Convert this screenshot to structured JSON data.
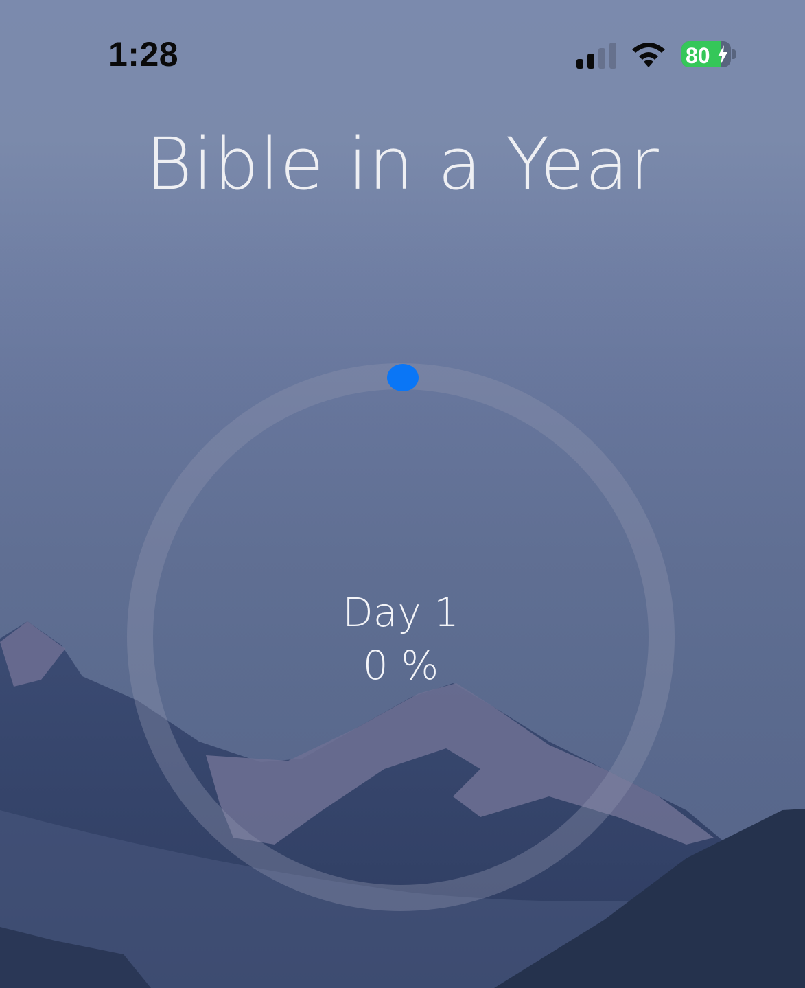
{
  "status_bar": {
    "time": "1:28",
    "battery_level": "80",
    "battery_fraction": 0.8,
    "charging": true,
    "signal_bars_active": 2,
    "signal_bars_total": 4,
    "icons": [
      "signal-icon",
      "wifi-icon",
      "battery-icon",
      "bolt-icon"
    ]
  },
  "header": {
    "title": "Bible in a Year"
  },
  "progress": {
    "day_label": "Day 1",
    "percent_label": "0 %",
    "percent_value": 0,
    "ring_track_color": "#8d94ad",
    "indicator_color": "#0a76f6"
  },
  "colors": {
    "title_text": "#eeeff3",
    "sky_top": "#7b8aad",
    "mountain_dark": "#2e3d62",
    "mountain_darkest": "#25324d",
    "battery_green": "#35c759"
  }
}
